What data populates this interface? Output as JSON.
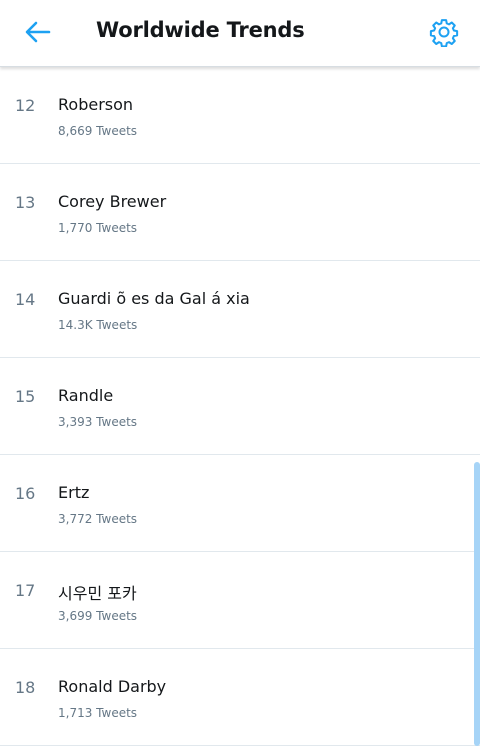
{
  "header": {
    "title": "Worldwide Trends",
    "back_icon": "arrow-left-icon",
    "settings_icon": "gear-icon",
    "accent_color": "#1da1f2"
  },
  "trends": [
    {
      "rank": "12",
      "name": "Roberson",
      "count": "8,669 Tweets"
    },
    {
      "rank": "13",
      "name": "Corey Brewer",
      "count": "1,770 Tweets"
    },
    {
      "rank": "14",
      "name": "Guardi õ es da Gal á xia",
      "count": "14.3K Tweets"
    },
    {
      "rank": "15",
      "name": "Randle",
      "count": "3,393 Tweets"
    },
    {
      "rank": "16",
      "name": "Ertz",
      "count": "3,772 Tweets"
    },
    {
      "rank": "17",
      "name": "시우민 포카",
      "count": "3,699 Tweets"
    },
    {
      "rank": "18",
      "name": "Ronald Darby",
      "count": "1,713 Tweets"
    }
  ]
}
